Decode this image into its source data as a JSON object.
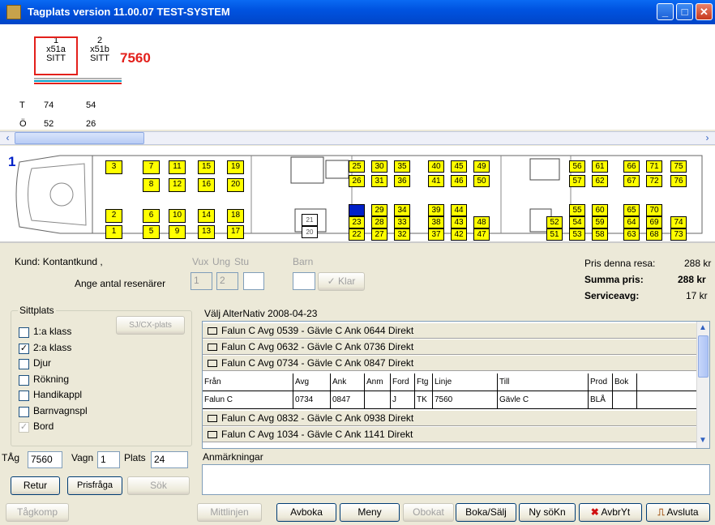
{
  "window": {
    "title": "Tagplats version 11.00.07   TEST-SYSTEM",
    "min": "_",
    "max": "□",
    "close": "✕"
  },
  "overview": {
    "cars": [
      {
        "num": "1",
        "code": "x51a",
        "type": "SITT"
      },
      {
        "num": "2",
        "code": "x51b",
        "type": "SITT"
      }
    ],
    "train_number": "7560",
    "rows": [
      {
        "label": "T",
        "values": [
          "74",
          "54"
        ]
      },
      {
        "label": "Ö",
        "values": [
          "52",
          "26"
        ]
      }
    ]
  },
  "seatmap": {
    "car_label": "1",
    "selected_seat": "24",
    "seats": [
      "3",
      "7",
      "8",
      "11",
      "12",
      "15",
      "16",
      "19",
      "20",
      "2",
      "1",
      "6",
      "5",
      "10",
      "9",
      "14",
      "13",
      "18",
      "17",
      "25",
      "26",
      "30",
      "31",
      "35",
      "36",
      "24",
      "23",
      "22",
      "29",
      "28",
      "27",
      "34",
      "33",
      "32",
      "21",
      "20",
      "40",
      "41",
      "45",
      "46",
      "49",
      "50",
      "39",
      "38",
      "37",
      "44",
      "43",
      "42",
      "48",
      "47",
      "56",
      "57",
      "61",
      "62",
      "66",
      "67",
      "71",
      "72",
      "75",
      "76",
      "52",
      "51",
      "55",
      "54",
      "53",
      "60",
      "59",
      "58",
      "65",
      "64",
      "63",
      "70",
      "69",
      "68",
      "74",
      "73"
    ]
  },
  "customer": {
    "label": "Kund: Kontantkund ,",
    "passengers_label": "Ange antal resenärer"
  },
  "passenger_types": {
    "vux": "Vux",
    "ung": "Ung",
    "stu": "Stu",
    "barn": "Barn",
    "vux_value": "1",
    "ung_value": "2",
    "stu_value": "",
    "barn_value": "",
    "klar": "Klar"
  },
  "price": {
    "this_trip_label": "Pris denna resa:",
    "this_trip_value": "288 kr",
    "sum_label": "Summa pris:",
    "sum_value": "288 kr",
    "service_label": "Serviceavg:",
    "service_value": "17 kr"
  },
  "sittplats": {
    "title": "Sittplats",
    "sj_button": "SJ/CX-plats",
    "options": [
      {
        "label": "1:a klass",
        "checked": false
      },
      {
        "label": "2:a klass",
        "checked": true
      },
      {
        "label": "Djur",
        "checked": false
      },
      {
        "label": "Rökning",
        "checked": false
      },
      {
        "label": "Handikappl",
        "checked": false
      },
      {
        "label": "Barnvagnspl",
        "checked": false
      },
      {
        "label": "Bord",
        "checked": true,
        "disabled": true
      }
    ]
  },
  "alternatives": {
    "title": "Välj AlterNativ 2008-04-23",
    "rows": [
      "Falun C Avg 0539 - Gävle C Ank 0644  Direkt",
      "Falun C Avg 0632 - Gävle C Ank 0736  Direkt",
      "Falun C Avg 0734 - Gävle C Ank 0847  Direkt",
      "Falun C Avg 0832 - Gävle C Ank 0938  Direkt",
      "Falun C Avg 1034 - Gävle C Ank 1141  Direkt"
    ],
    "columns": [
      "Från",
      "Avg",
      "Ank",
      "Anm",
      "Ford",
      "Ftg",
      "Linje",
      "Till",
      "Prod",
      "Bok"
    ],
    "detail": [
      "Falun C",
      "0734",
      "0847",
      "",
      "J",
      "TK",
      "7560",
      "Gävle C",
      "BLÅ",
      ""
    ]
  },
  "trip": {
    "tag_label": "TÅg",
    "tag_value": "7560",
    "vagn_label": "Vagn",
    "vagn_value": "1",
    "plats_label": "Plats",
    "plats_value": "24"
  },
  "buttons": {
    "retur": "Retur",
    "prisfraga": "Prisfråga",
    "sok": "Sök",
    "tagkomp": "Tågkomp",
    "mittlinjen": "Mittlinjen",
    "avboka": "Avboka",
    "meny": "Meny",
    "obokat": "Obokat",
    "boka_salj": "Boka/Sälj",
    "ny_sokn": "Ny söKn",
    "avbryt": "AvbrYt",
    "avsluta": "Avsluta"
  },
  "remarks_label": "Anmärkningar"
}
